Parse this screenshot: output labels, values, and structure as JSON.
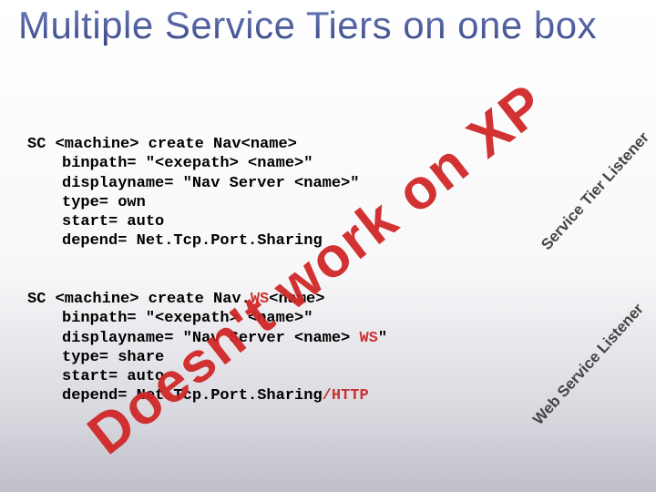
{
  "title": "Multiple Service Tiers on one box",
  "block1": {
    "l1a": "SC <machine> create Nav<name>",
    "l2": "binpath= \"<exepath> <name>\"",
    "l3": "displayname= \"Nav Server <name>\"",
    "l4": "type= own",
    "l5": "start= auto",
    "l6": "depend= Net.Tcp.Port.Sharing"
  },
  "block2": {
    "l1a": "SC <machine> create Nav.",
    "l1b": "WS",
    "l1c": "<name>",
    "l2": "binpath= \"<exepath> <name>\"",
    "l3a": "displayname= \"Nav Server <name> ",
    "l3b": "WS",
    "l3c": "\"",
    "l4": "type= share",
    "l5": "start= auto",
    "l6a": "depend= Net.Tcp.Port.Sharing",
    "l6b": "/HTTP"
  },
  "stamp": "Doesn't work on XP",
  "label1": "Service Tier Listener",
  "label2": "Web Service Listener"
}
